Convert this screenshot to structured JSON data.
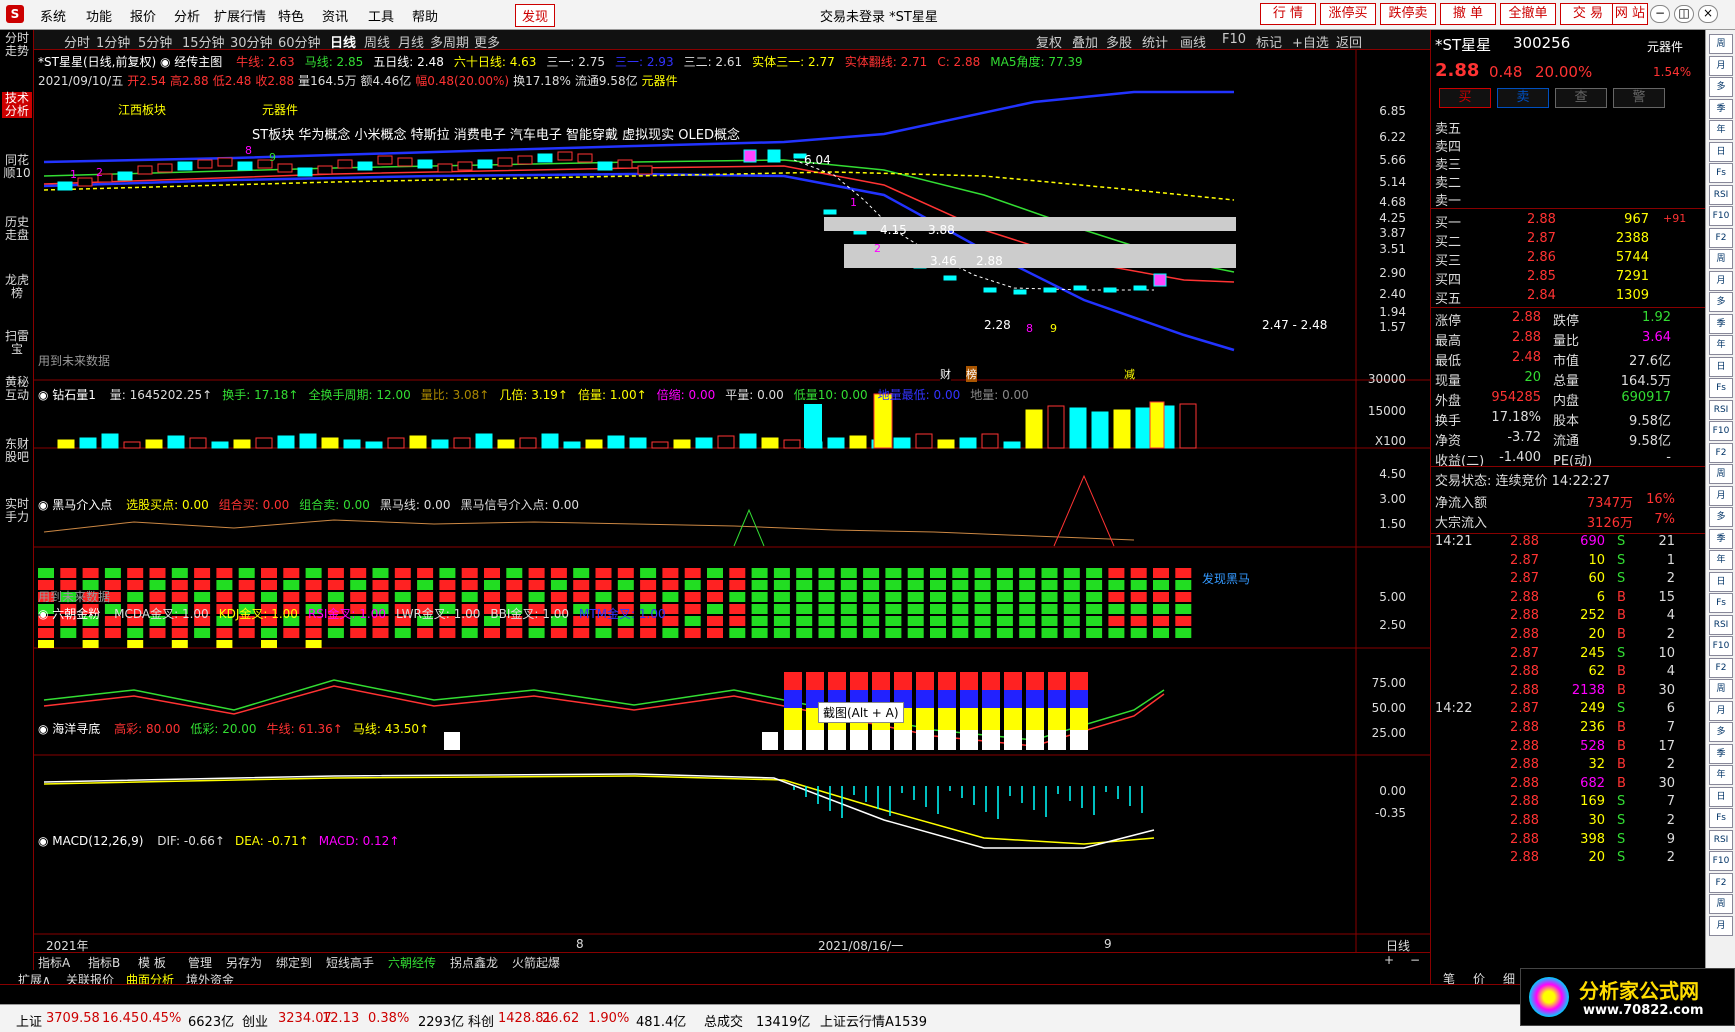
{
  "menu": {
    "items": [
      "系统",
      "功能",
      "报价",
      "分析",
      "扩展行情",
      "特色",
      "资讯",
      "工具",
      "帮助"
    ],
    "discover": "发现",
    "title": "交易未登录  *ST星星",
    "buttons": [
      "行 情",
      "涨停买",
      "跌停卖",
      "撤 单",
      "全撤单",
      "交 易",
      "网 站"
    ]
  },
  "sidebar": {
    "tabs": [
      "分时走势",
      "技术分析",
      "同花顺10",
      "历史走盘",
      "龙虎榜",
      "扫雷宝",
      "黄秘互动",
      "东财股吧",
      "实时手力"
    ]
  },
  "period": {
    "items": [
      "分时",
      "1分钟",
      "5分钟",
      "15分钟",
      "30分钟",
      "60分钟",
      "日线",
      "周线",
      "月线",
      "多周期",
      "更多"
    ],
    "right": [
      "复权",
      "叠加",
      "多股",
      "统计",
      "画线",
      "F10",
      "标记",
      "+自选",
      "返回"
    ]
  },
  "main": {
    "name": "*ST星星",
    "mode": "(日线,前复权)",
    "formula": "经传主图",
    "ma": [
      {
        "t": "牛线: 2.63",
        "c": "#ff3333"
      },
      {
        "t": "马线: 2.85",
        "c": "#33dd33"
      },
      {
        "t": "五日线: 2.48",
        "c": "#ffffff"
      },
      {
        "t": "六十日线: 4.63",
        "c": "#ffff00"
      },
      {
        "t": "三一: 2.75",
        "c": "#ddd"
      },
      {
        "t": "三一: 2.93",
        "c": "#3333ff"
      },
      {
        "t": "三二: 2.61",
        "c": "#ddd"
      },
      {
        "t": "实体三一: 2.77",
        "c": "#ffff00"
      },
      {
        "t": "实体翻线: 2.71",
        "c": "#ff3333"
      },
      {
        "t": "C: 2.88",
        "c": "#ff3333"
      },
      {
        "t": "MA5角度: 77.39",
        "c": "#33dd33"
      }
    ],
    "info": [
      {
        "t": "2021/09/10/五",
        "c": "#ddd"
      },
      {
        "t": "开2.54",
        "c": "#ff3333"
      },
      {
        "t": "高2.88",
        "c": "#ff3333"
      },
      {
        "t": "低2.48",
        "c": "#ff3333"
      },
      {
        "t": "收2.88",
        "c": "#ff3333"
      },
      {
        "t": "量164.5万",
        "c": "#ddd"
      },
      {
        "t": "额4.46亿",
        "c": "#ddd"
      },
      {
        "t": "幅0.48(20.00%)",
        "c": "#ff3333"
      },
      {
        "t": "换17.18%",
        "c": "#ddd"
      },
      {
        "t": "流通9.58亿",
        "c": "#ddd"
      },
      {
        "t": "元器件",
        "c": "#ffff00"
      }
    ],
    "concepts": {
      "board1": "江西板块",
      "board2": "元器件",
      "list": "ST板块 华为概念 小米概念 特斯拉 消费电子 汽车电子 智能穿戴 虚拟现实 OLED概念"
    },
    "yaxis": [
      "6.85",
      "6.22",
      "5.66",
      "5.14",
      "4.68",
      "4.25",
      "3.87",
      "3.51",
      "2.90",
      "2.40",
      "1.94",
      "1.57"
    ],
    "annotations": {
      "a604": "6.04",
      "a415": "4.15",
      "a388": "3.88",
      "a346": "3.46",
      "a288": "2.88",
      "a228": "2.28",
      "range": "2.47 - 2.48",
      "cai": "财",
      "bang": "榜",
      "jian": "减",
      "future": "用到未来数据"
    }
  },
  "vol": {
    "name": "钻石量1",
    "fields": [
      {
        "t": "量: 1645202.25↑",
        "c": "#ddd"
      },
      {
        "t": "换手: 17.18↑",
        "c": "#33dd33"
      },
      {
        "t": "全换手周期: 12.00",
        "c": "#33dd33"
      },
      {
        "t": "量比: 3.08↑",
        "c": "#aa8800"
      },
      {
        "t": "几倍: 3.19↑",
        "c": "#ffff00"
      },
      {
        "t": "倍量: 1.00↑",
        "c": "#ffff00"
      },
      {
        "t": "倍缩: 0.00",
        "c": "#ff00ff"
      },
      {
        "t": "平量: 0.00",
        "c": "#ddd"
      },
      {
        "t": "低量10: 0.00",
        "c": "#33dd33"
      },
      {
        "t": "地量最低: 0.00",
        "c": "#3333ff"
      },
      {
        "t": "地量: 0.00",
        "c": "#888"
      }
    ],
    "yaxis": [
      "30000",
      "15000",
      "X100"
    ]
  },
  "heima": {
    "name": "黑马介入点",
    "fields": [
      {
        "t": "选股买点: 0.00",
        "c": "#ffff00"
      },
      {
        "t": "组合买: 0.00",
        "c": "#ff3333"
      },
      {
        "t": "组合卖: 0.00",
        "c": "#33dd33"
      },
      {
        "t": "黑马线: 0.00",
        "c": "#ddd"
      },
      {
        "t": "黑马信号介入点: 0.00",
        "c": "#ddd"
      }
    ],
    "yaxis": [
      "4.50",
      "3.00",
      "1.50"
    ],
    "found": "发现黑马",
    "future": "用到未来数据"
  },
  "liuchao": {
    "name": "六朝金粉",
    "fields": [
      {
        "t": "MCDA金叉: 1.00",
        "c": "#ddd"
      },
      {
        "t": "KDJ金叉: 1.00",
        "c": "#ffff00"
      },
      {
        "t": "RSI金叉: 1.00",
        "c": "#ff00ff"
      },
      {
        "t": "LWR金叉: 1.00",
        "c": "#ddd"
      },
      {
        "t": "BBI金叉: 1.00",
        "c": "#ddd"
      },
      {
        "t": "MTM金叉: 1.00",
        "c": "#3333ff"
      }
    ],
    "yaxis": [
      "5.00",
      "2.50"
    ],
    "tooltip": "截图(Alt + A)"
  },
  "haiyang": {
    "name": "海洋寻底",
    "fields": [
      {
        "t": "高彩: 80.00",
        "c": "#ff3333"
      },
      {
        "t": "低彩: 20.00",
        "c": "#33dd33"
      },
      {
        "t": "牛线: 61.36↑",
        "c": "#ff3333"
      },
      {
        "t": "马线: 43.50↑",
        "c": "#ffff00"
      }
    ],
    "yaxis": [
      "75.00",
      "50.00",
      "25.00"
    ]
  },
  "macd": {
    "name": "MACD(12,26,9)",
    "fields": [
      {
        "t": "DIF: -0.66↑",
        "c": "#ddd"
      },
      {
        "t": "DEA: -0.71↑",
        "c": "#ffff00"
      },
      {
        "t": "MACD: 0.12↑",
        "c": "#ff00ff"
      }
    ],
    "yaxis": [
      "0.00",
      "-0.35"
    ]
  },
  "xaxis": {
    "y2021": "2021年",
    "m8": "8",
    "d0816": "2021/08/16/一",
    "m9": "9",
    "daily": "日线"
  },
  "tabs": {
    "row1": [
      "指标A",
      "指标B",
      "模 板",
      "管理",
      "另存为",
      "绑定到",
      "短线高手",
      "六朝经传",
      "拐点鑫龙",
      "火箭起爆"
    ],
    "row2": [
      "扩展∧",
      "关联报价",
      "曲面分析",
      "境外资金"
    ]
  },
  "quote": {
    "name": "*ST星星",
    "code": "300256",
    "tag": "元器件",
    "price": "2.88",
    "chg": "0.48",
    "pct": "20.00%",
    "turn": "1.54%",
    "actions": [
      "买",
      "卖",
      "查",
      "警"
    ],
    "sells": [
      "卖五",
      "卖四",
      "卖三",
      "卖二",
      "卖一"
    ],
    "buys": [
      {
        "l": "买一",
        "p": "2.88",
        "v": "967",
        "x": "+91"
      },
      {
        "l": "买二",
        "p": "2.87",
        "v": "2388",
        "x": ""
      },
      {
        "l": "买三",
        "p": "2.86",
        "v": "5744",
        "x": ""
      },
      {
        "l": "买四",
        "p": "2.85",
        "v": "7291",
        "x": ""
      },
      {
        "l": "买五",
        "p": "2.84",
        "v": "1309",
        "x": ""
      }
    ],
    "stats": [
      {
        "a": "涨停",
        "b": "2.88",
        "bc": "#ff3333",
        "c": "跌停",
        "d": "1.92",
        "dc": "#33dd33"
      },
      {
        "a": "最高",
        "b": "2.88",
        "bc": "#ff3333",
        "c": "量比",
        "d": "3.64",
        "dc": "#ff00ff"
      },
      {
        "a": "最低",
        "b": "2.48",
        "bc": "#ff3333",
        "c": "市值",
        "d": "27.6亿",
        "dc": "#ddd"
      },
      {
        "a": "现量",
        "b": "20",
        "bc": "#33dd33",
        "c": "总量",
        "d": "164.5万",
        "dc": "#ddd"
      },
      {
        "a": "外盘",
        "b": "954285",
        "bc": "#ff3333",
        "c": "内盘",
        "d": "690917",
        "dc": "#33dd33"
      },
      {
        "a": "换手",
        "b": "17.18%",
        "bc": "#ddd",
        "c": "股本",
        "d": "9.58亿",
        "dc": "#ddd"
      },
      {
        "a": "净资",
        "b": "-3.72",
        "bc": "#ddd",
        "c": "流通",
        "d": "9.58亿",
        "dc": "#ddd"
      },
      {
        "a": "收益(二)",
        "b": "-1.400",
        "bc": "#ddd",
        "c": "PE(动)",
        "d": "-",
        "dc": "#ddd"
      }
    ],
    "status": "交易状态: 连续竞价 14:22:27",
    "flow": [
      {
        "a": "净流入额",
        "b": "7347万",
        "c": "16%"
      },
      {
        "a": "大宗流入",
        "b": "3126万",
        "c": "7%"
      }
    ],
    "ticks": [
      {
        "t": "14:21",
        "p": "2.88",
        "v": "690",
        "s": "S",
        "n": "21"
      },
      {
        "t": "",
        "p": "2.87",
        "v": "10",
        "s": "S",
        "n": "1"
      },
      {
        "t": "",
        "p": "2.87",
        "v": "60",
        "s": "S",
        "n": "2"
      },
      {
        "t": "",
        "p": "2.88",
        "v": "6",
        "s": "B",
        "n": "15"
      },
      {
        "t": "",
        "p": "2.88",
        "v": "252",
        "s": "B",
        "n": "4"
      },
      {
        "t": "",
        "p": "2.88",
        "v": "20",
        "s": "B",
        "n": "2"
      },
      {
        "t": "",
        "p": "2.87",
        "v": "245",
        "s": "S",
        "n": "10"
      },
      {
        "t": "",
        "p": "2.88",
        "v": "62",
        "s": "B",
        "n": "4"
      },
      {
        "t": "",
        "p": "2.88",
        "v": "2138",
        "s": "B",
        "n": "30"
      },
      {
        "t": "14:22",
        "p": "2.87",
        "v": "249",
        "s": "S",
        "n": "6"
      },
      {
        "t": "",
        "p": "2.88",
        "v": "236",
        "s": "B",
        "n": "7"
      },
      {
        "t": "",
        "p": "2.88",
        "v": "528",
        "s": "B",
        "n": "17"
      },
      {
        "t": "",
        "p": "2.88",
        "v": "32",
        "s": "B",
        "n": "2"
      },
      {
        "t": "",
        "p": "2.88",
        "v": "682",
        "s": "B",
        "n": "30"
      },
      {
        "t": "",
        "p": "2.88",
        "v": "169",
        "s": "S",
        "n": "7"
      },
      {
        "t": "",
        "p": "2.88",
        "v": "30",
        "s": "S",
        "n": "2"
      },
      {
        "t": "",
        "p": "2.88",
        "v": "398",
        "s": "S",
        "n": "9"
      },
      {
        "t": "",
        "p": "2.88",
        "v": "20",
        "s": "S",
        "n": "2"
      }
    ],
    "bottomtabs": [
      "笔",
      "价",
      "细"
    ]
  },
  "righttools": [
    "周",
    "月",
    "多",
    "季",
    "年",
    "日",
    "Fs",
    "RSI",
    "F10",
    "F2"
  ],
  "statusbar": [
    {
      "t": "上证",
      "c": "#000"
    },
    {
      "t": "3709.58",
      "c": "#c00"
    },
    {
      "t": "16.45",
      "c": "#c00"
    },
    {
      "t": "0.45%",
      "c": "#c00"
    },
    {
      "t": "6623亿",
      "c": "#000"
    },
    {
      "t": "创业",
      "c": "#000"
    },
    {
      "t": "3234.07",
      "c": "#c00"
    },
    {
      "t": "12.13",
      "c": "#c00"
    },
    {
      "t": "0.38%",
      "c": "#c00"
    },
    {
      "t": "2293亿",
      "c": "#000"
    },
    {
      "t": "科创",
      "c": "#000"
    },
    {
      "t": "1428.81",
      "c": "#c00"
    },
    {
      "t": "26.62",
      "c": "#c00"
    },
    {
      "t": "1.90%",
      "c": "#c00"
    },
    {
      "t": "481.4亿",
      "c": "#000"
    },
    {
      "t": "总成交",
      "c": "#000"
    },
    {
      "t": "13419亿",
      "c": "#000"
    },
    {
      "t": "上证云行情A1539",
      "c": "#000"
    }
  ],
  "logo": {
    "name": "分析家公式网",
    "url": "www.70822.com"
  }
}
